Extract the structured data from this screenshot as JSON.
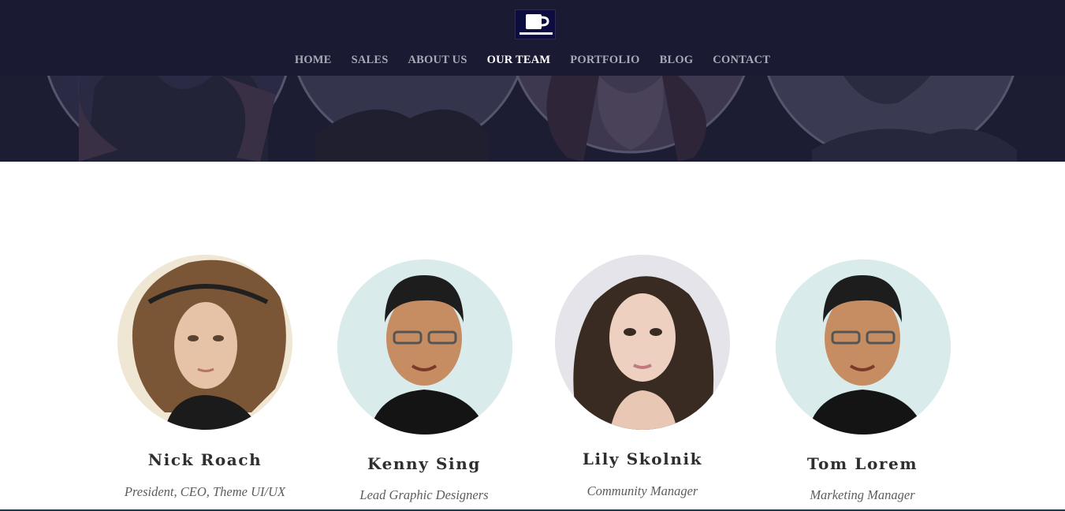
{
  "nav": {
    "logo_icon": "coffee-cup-icon",
    "items": [
      {
        "label": "HOME",
        "active": false
      },
      {
        "label": "SALES",
        "active": false
      },
      {
        "label": "ABOUT US",
        "active": false
      },
      {
        "label": "OUR TEAM",
        "active": true
      },
      {
        "label": "PORTFOLIO",
        "active": false
      },
      {
        "label": "BLOG",
        "active": false
      },
      {
        "label": "CONTACT",
        "active": false
      }
    ]
  },
  "team": {
    "members": [
      {
        "name": "Nick Roach",
        "role": "President, CEO, Theme UI/UX"
      },
      {
        "name": "Kenny Sing",
        "role": "Lead Graphic Designers"
      },
      {
        "name": "Lily Skolnik",
        "role": "Community Manager"
      },
      {
        "name": "Tom Lorem",
        "role": "Marketing Manager"
      }
    ]
  },
  "colors": {
    "header_bg": "#1a1a32",
    "nav_text": "#a9a9b8",
    "nav_active": "#ffffff",
    "name_text": "#2e2e2e",
    "role_text": "#5c5c5c",
    "avatar_bg_male": "#d9ebea"
  }
}
